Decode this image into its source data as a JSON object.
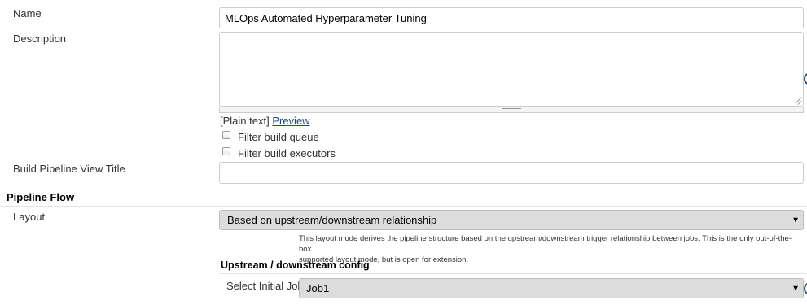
{
  "form": {
    "name_label": "Name",
    "name_value": "MLOps Automated Hyperparameter Tuning",
    "description_label": "Description",
    "description_value": "",
    "format_prefix": "[Plain text]",
    "preview_link": "Preview",
    "filter_build_queue_label": "Filter build queue",
    "filter_build_executors_label": "Filter build executors",
    "view_title_label": "Build Pipeline View Title",
    "view_title_value": ""
  },
  "pipeline_flow": {
    "heading": "Pipeline Flow",
    "layout_label": "Layout",
    "layout_selected": "Based on upstream/downstream relationship",
    "layout_help_line1": "This layout mode derives the pipeline structure based on the upstream/downstream trigger relationship between jobs. This is the only out-of-the-box",
    "layout_help_line2": "supported layout mode, but is open for extension.",
    "upstream_heading": "Upstream / downstream config",
    "initial_job_label": "Select Initial Job",
    "initial_job_selected": "Job1"
  },
  "icons": {
    "caret": "▼",
    "help": "help-icon"
  },
  "colors": {
    "link": "#204a87",
    "select_bg": "#dcdcdc"
  }
}
